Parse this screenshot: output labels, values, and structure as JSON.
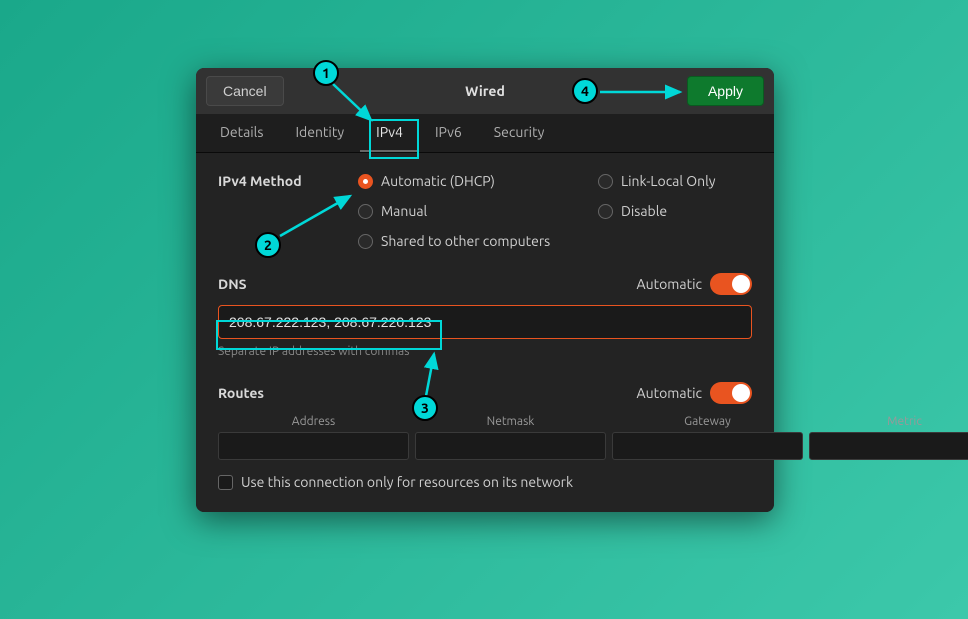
{
  "header": {
    "cancel_label": "Cancel",
    "title": "Wired",
    "apply_label": "Apply"
  },
  "tabs": [
    "Details",
    "Identity",
    "IPv4",
    "IPv6",
    "Security"
  ],
  "active_tab_index": 2,
  "method": {
    "title": "IPv4 Method",
    "options_left": [
      "Automatic (DHCP)",
      "Manual",
      "Shared to other computers"
    ],
    "options_right": [
      "Link-Local Only",
      "Disable"
    ],
    "selected": "Automatic (DHCP)"
  },
  "dns": {
    "title": "DNS",
    "automatic_label": "Automatic",
    "value": "208.67.222.123, 208.67.220.123",
    "helper": "Separate IP addresses with commas"
  },
  "routes": {
    "title": "Routes",
    "automatic_label": "Automatic",
    "columns": [
      "Address",
      "Netmask",
      "Gateway",
      "Metric"
    ]
  },
  "checkbox_label": "Use this connection only for resources on its network",
  "annotations": {
    "1": "1",
    "2": "2",
    "3": "3",
    "4": "4"
  }
}
